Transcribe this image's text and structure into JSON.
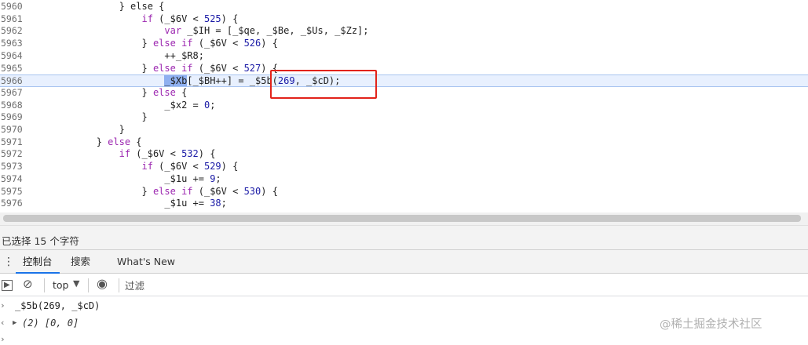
{
  "editor": {
    "lines": [
      {
        "num": "5960",
        "parts": [
          [
            "",
            "                } else {"
          ]
        ]
      },
      {
        "num": "5961",
        "parts": [
          [
            "",
            "                    "
          ],
          [
            "kw",
            "if"
          ],
          [
            "",
            " (_$6V < "
          ],
          [
            "num",
            "525"
          ],
          [
            "",
            ") {"
          ]
        ]
      },
      {
        "num": "5962",
        "parts": [
          [
            "",
            "                        "
          ],
          [
            "kw",
            "var"
          ],
          [
            "",
            " _$IH = [_$qe, _$Be, _$Us, _$Zz];"
          ]
        ]
      },
      {
        "num": "5963",
        "parts": [
          [
            "",
            "                    } "
          ],
          [
            "kw",
            "else if"
          ],
          [
            "",
            " (_$6V < "
          ],
          [
            "num",
            "526"
          ],
          [
            "",
            ") {"
          ]
        ]
      },
      {
        "num": "5964",
        "parts": [
          [
            "",
            "                        ++_$R8;"
          ]
        ]
      },
      {
        "num": "5965",
        "parts": [
          [
            "",
            "                    } "
          ],
          [
            "kw",
            "else if"
          ],
          [
            "",
            " (_$6V < "
          ],
          [
            "num",
            "527"
          ],
          [
            "",
            ") {"
          ]
        ]
      },
      {
        "num": "5966",
        "parts": [
          [
            "",
            "                        "
          ],
          [
            "sel",
            "_$Xb"
          ],
          [
            "",
            "[_$BH++] = _$5b("
          ],
          [
            "num",
            "269"
          ],
          [
            "",
            ", _$cD);"
          ]
        ],
        "current": true
      },
      {
        "num": "5967",
        "parts": [
          [
            "",
            "                    } "
          ],
          [
            "kw",
            "else"
          ],
          [
            "",
            " {"
          ]
        ]
      },
      {
        "num": "5968",
        "parts": [
          [
            "",
            "                        _$x2 = "
          ],
          [
            "num",
            "0"
          ],
          [
            "",
            ";"
          ]
        ]
      },
      {
        "num": "5969",
        "parts": [
          [
            "",
            "                    }"
          ]
        ]
      },
      {
        "num": "5970",
        "parts": [
          [
            "",
            "                }"
          ]
        ]
      },
      {
        "num": "5971",
        "parts": [
          [
            "",
            "            } "
          ],
          [
            "kw",
            "else"
          ],
          [
            "",
            " {"
          ]
        ]
      },
      {
        "num": "5972",
        "parts": [
          [
            "",
            "                "
          ],
          [
            "kw",
            "if"
          ],
          [
            "",
            " (_$6V < "
          ],
          [
            "num",
            "532"
          ],
          [
            "",
            ") {"
          ]
        ]
      },
      {
        "num": "5973",
        "parts": [
          [
            "",
            "                    "
          ],
          [
            "kw",
            "if"
          ],
          [
            "",
            " (_$6V < "
          ],
          [
            "num",
            "529"
          ],
          [
            "",
            ") {"
          ]
        ]
      },
      {
        "num": "5974",
        "parts": [
          [
            "",
            "                        _$1u += "
          ],
          [
            "num",
            "9"
          ],
          [
            "",
            ";"
          ]
        ]
      },
      {
        "num": "5975",
        "parts": [
          [
            "",
            "                    } "
          ],
          [
            "kw",
            "else if"
          ],
          [
            "",
            " (_$6V < "
          ],
          [
            "num",
            "530"
          ],
          [
            "",
            ") {"
          ]
        ]
      },
      {
        "num": "5976",
        "parts": [
          [
            "",
            "                        _$1u += "
          ],
          [
            "num",
            "38"
          ],
          [
            "",
            ";"
          ]
        ]
      }
    ]
  },
  "status_bar": {
    "text": "已选择 15 个字符"
  },
  "drawer": {
    "menu_icon": "⋮",
    "tabs": [
      {
        "label": "控制台",
        "active": true
      },
      {
        "label": "搜索",
        "active": false
      },
      {
        "label": "What's New",
        "active": false
      }
    ]
  },
  "toolbar": {
    "sidebar_icon": "▶",
    "clear_icon": "⊘",
    "context": "top",
    "context_arrow": "▼",
    "eye_icon": "◉",
    "filter_placeholder": "过滤"
  },
  "console": {
    "input_marker": "›",
    "input": "_$5b(269, _$cD)",
    "result_marker": "‹",
    "expand_icon": "▶",
    "result": "(2) [0, 0]",
    "prompt_marker": "›"
  },
  "watermark": "@稀土掘金技术社区",
  "colors": {
    "highlight_box": "#e2231a",
    "active_tab": "#1a73e8"
  }
}
